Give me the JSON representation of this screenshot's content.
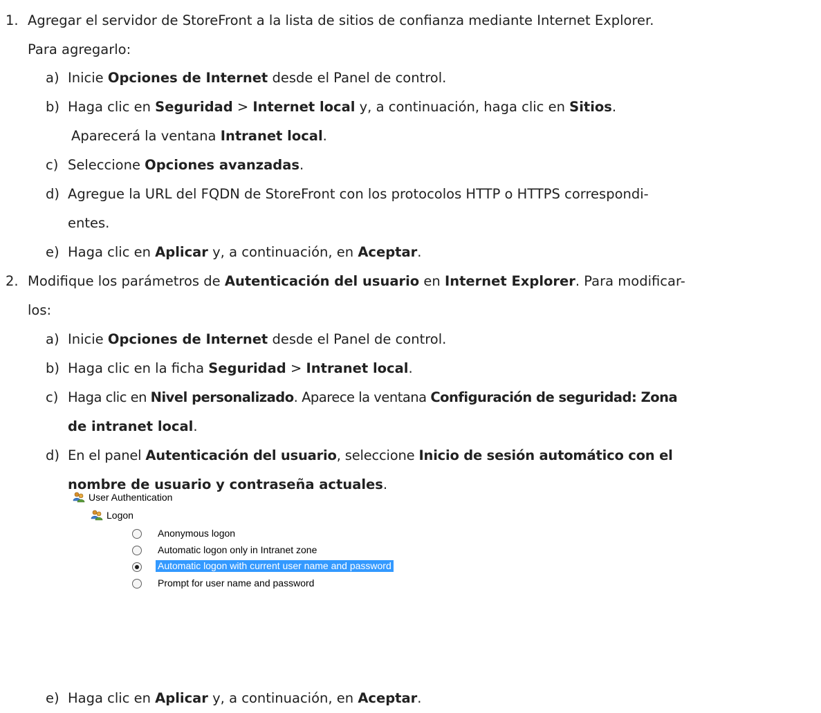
{
  "steps": [
    {
      "num": "1.",
      "line1": "Agregar el servidor de StoreFront a la lista de sitios de confianza mediante Internet Explorer.",
      "line2": "Para agregarlo:",
      "sub": [
        {
          "letter": "a)",
          "t1": "Inicie ",
          "b1": "Opciones de Internet",
          "t2": " desde el Panel de control."
        },
        {
          "letter": "b)",
          "t1": "Haga clic en ",
          "b1": "Seguridad",
          "t2": " > ",
          "b2": "Internet local",
          "t3": " y, a continuación, haga clic en ",
          "b3": "Sitios",
          "t4": ".",
          "cont_t1": "Aparecerá la ventana ",
          "cont_b1": "Intranet local",
          "cont_t2": "."
        },
        {
          "letter": "c)",
          "t1": "Seleccione ",
          "b1": "Opciones avanzadas",
          "t2": "."
        },
        {
          "letter": "d)",
          "line1": "Agregue la URL del FQDN de StoreFront con los protocolos HTTP o HTTPS correspondi-",
          "line2": "entes."
        },
        {
          "letter": "e)",
          "t1": "Haga clic en ",
          "b1": "Aplicar",
          "t2": " y, a continuación, en ",
          "b2": "Aceptar",
          "t3": "."
        }
      ]
    },
    {
      "num": "2.",
      "t1": "Modifique los parámetros de ",
      "b1": "Autenticación del usuario",
      "t2": " en ",
      "b2": "Internet Explorer",
      "t3": ". Para modificar-",
      "line2": "los:",
      "sub": [
        {
          "letter": "a)",
          "t1": "Inicie ",
          "b1": "Opciones de Internet",
          "t2": " desde el Panel de control."
        },
        {
          "letter": "b)",
          "t1": "Haga clic en la ficha ",
          "b1": "Seguridad",
          "t2": " > ",
          "b2": "Intranet local",
          "t3": "."
        },
        {
          "letter": "c)",
          "t1": "Haga clic en ",
          "b1": "Nivel personalizado",
          "t2": ". Aparece la ventana ",
          "b2": "Configuración de seguridad: Zona",
          "b3": "de intranet local",
          "t3": "."
        },
        {
          "letter": "d)",
          "t1": "En el panel ",
          "b1": "Autenticación del usuario",
          "t2": ", seleccione ",
          "b2": "Inicio de sesión automático con el",
          "b3": "nombre de usuario y contraseña actuales",
          "t3": "."
        },
        {
          "letter": "e)",
          "t1": "Haga clic en ",
          "b1": "Aplicar",
          "t2": " y, a continuación, en ",
          "b2": "Aceptar",
          "t3": "."
        }
      ]
    }
  ],
  "screenshot": {
    "group_label": "User Authentication",
    "subgroup_label": "Logon",
    "group_icon": "users-icon",
    "options": [
      {
        "label": "Anonymous logon",
        "checked": false,
        "selected": false
      },
      {
        "label": "Automatic logon only in Intranet zone",
        "checked": false,
        "selected": false
      },
      {
        "label": "Automatic logon with current user name and password",
        "checked": true,
        "selected": true
      },
      {
        "label": "Prompt for user name and password",
        "checked": false,
        "selected": false
      }
    ],
    "colors": {
      "selection": "#3399ff",
      "selection_text": "#ffffff"
    }
  }
}
